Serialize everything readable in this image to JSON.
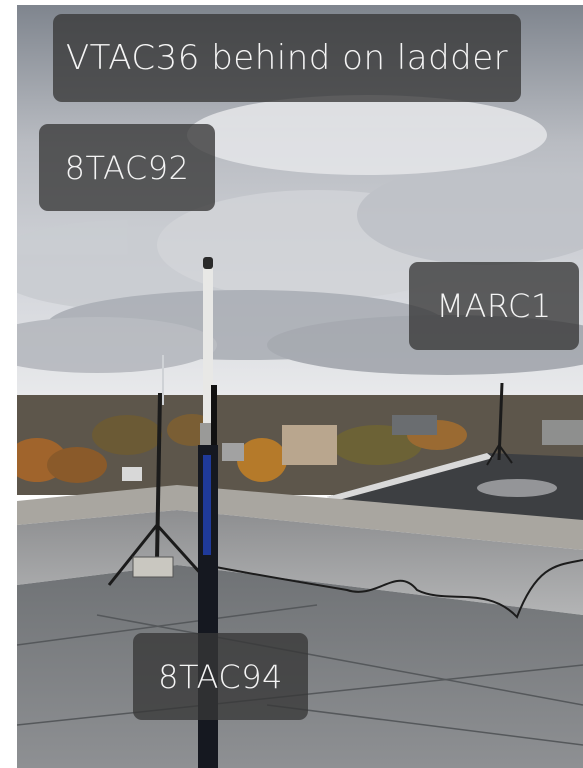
{
  "photo": {
    "labels": [
      {
        "id": "vtac36",
        "text": "VTAC36 behind on ladder"
      },
      {
        "id": "8tac92",
        "text": "8TAC92"
      },
      {
        "id": "marc1",
        "text": "MARC1"
      },
      {
        "id": "8tac94",
        "text": "8TAC94"
      }
    ]
  },
  "colors": {
    "sky_top": "#8e949c",
    "sky_bottom": "#e4e6ea",
    "roof": "#7f8184",
    "parapet": "#a9a6a0",
    "foliage": "#a0642c",
    "label_bg": "#373737"
  }
}
